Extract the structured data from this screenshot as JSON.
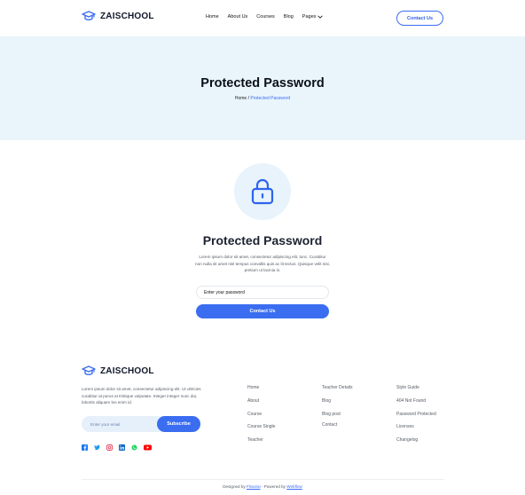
{
  "header": {
    "logo_text": "ZAISCHOOL",
    "nav": [
      "Home",
      "About Us",
      "Courses",
      "Blog",
      "Pages"
    ],
    "contact_label": "Contact Us"
  },
  "hero": {
    "title": "Protected Password",
    "breadcrumb_home": "Home",
    "breadcrumb_sep": " / ",
    "breadcrumb_current": "Protected Password"
  },
  "main": {
    "title": "Protected Password",
    "description": "Lorem ipsum dolor sit amet, consectetur adipiscing elit, tonc. Curabitur non nulla sit amet nisl tempus convallis quis ac lit tectus. Quisque velit nisi, pretium ut lacinia in.",
    "password_placeholder": "Enter your password",
    "submit_label": "Contact Us"
  },
  "footer": {
    "logo_text": "ZAISCHOOL",
    "description": "Lorem ipsum dolor sit amet, consectetur adipiscing elit. Ut ultricies curabitur at purus at tristique vulputate. Integer integer nunc dui, lobortis aliquam leo enim id.",
    "email_placeholder": "Enter your email",
    "subscribe_label": "Subscribe",
    "socials": [
      "facebook-icon",
      "twitter-icon",
      "instagram-icon",
      "linkedin-icon",
      "whatsapp-icon",
      "youtube-icon"
    ],
    "col1": [
      "Home",
      "About",
      "Course",
      "Course Single",
      "Teacher"
    ],
    "col2": [
      "Teacher Details",
      "Blog",
      "Blog post",
      "Contact"
    ],
    "col3": [
      "Style Guide",
      "404 Not Found",
      "Password Protected",
      "Licenses",
      "Changelog"
    ],
    "credit_prefix": "Designed by ",
    "credit_designer": "Flowzai",
    "credit_mid": " - Powered by ",
    "credit_platform": "Webflow"
  },
  "colors": {
    "accent": "#3a6df0",
    "hero_bg": "#eaf5fb",
    "lock_bg": "#e8f3fb"
  }
}
